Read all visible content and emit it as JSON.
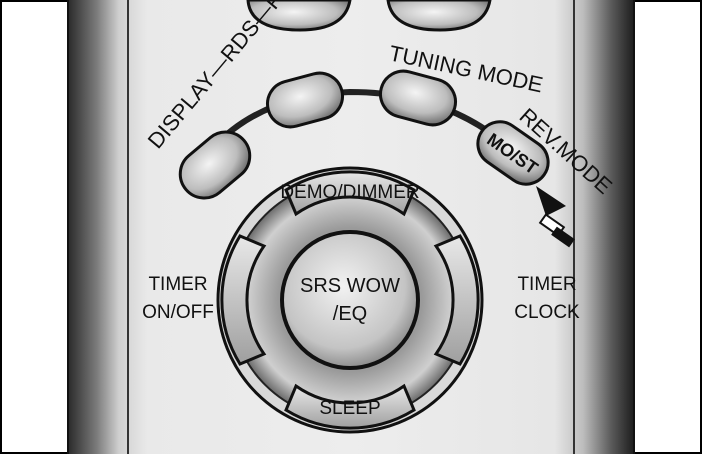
{
  "remote": {
    "top_labels": {
      "display_rds_pty": "DISPLAY—RDS—PTY",
      "tuning_mode": "TUNING MODE",
      "rev_mode": "REV.MODE"
    },
    "buttons": {
      "mo_st": "MO/ST",
      "demo_dimmer": "DEMO/DIMMER",
      "srs_wow_line1": "SRS WOW",
      "srs_wow_line2": "/EQ",
      "sleep": "SLEEP"
    },
    "side_labels": {
      "timer_onoff_line1": "TIMER",
      "timer_onoff_line2": "ON/OFF",
      "timer_clock_line1": "TIMER",
      "timer_clock_line2": "CLOCK"
    }
  }
}
